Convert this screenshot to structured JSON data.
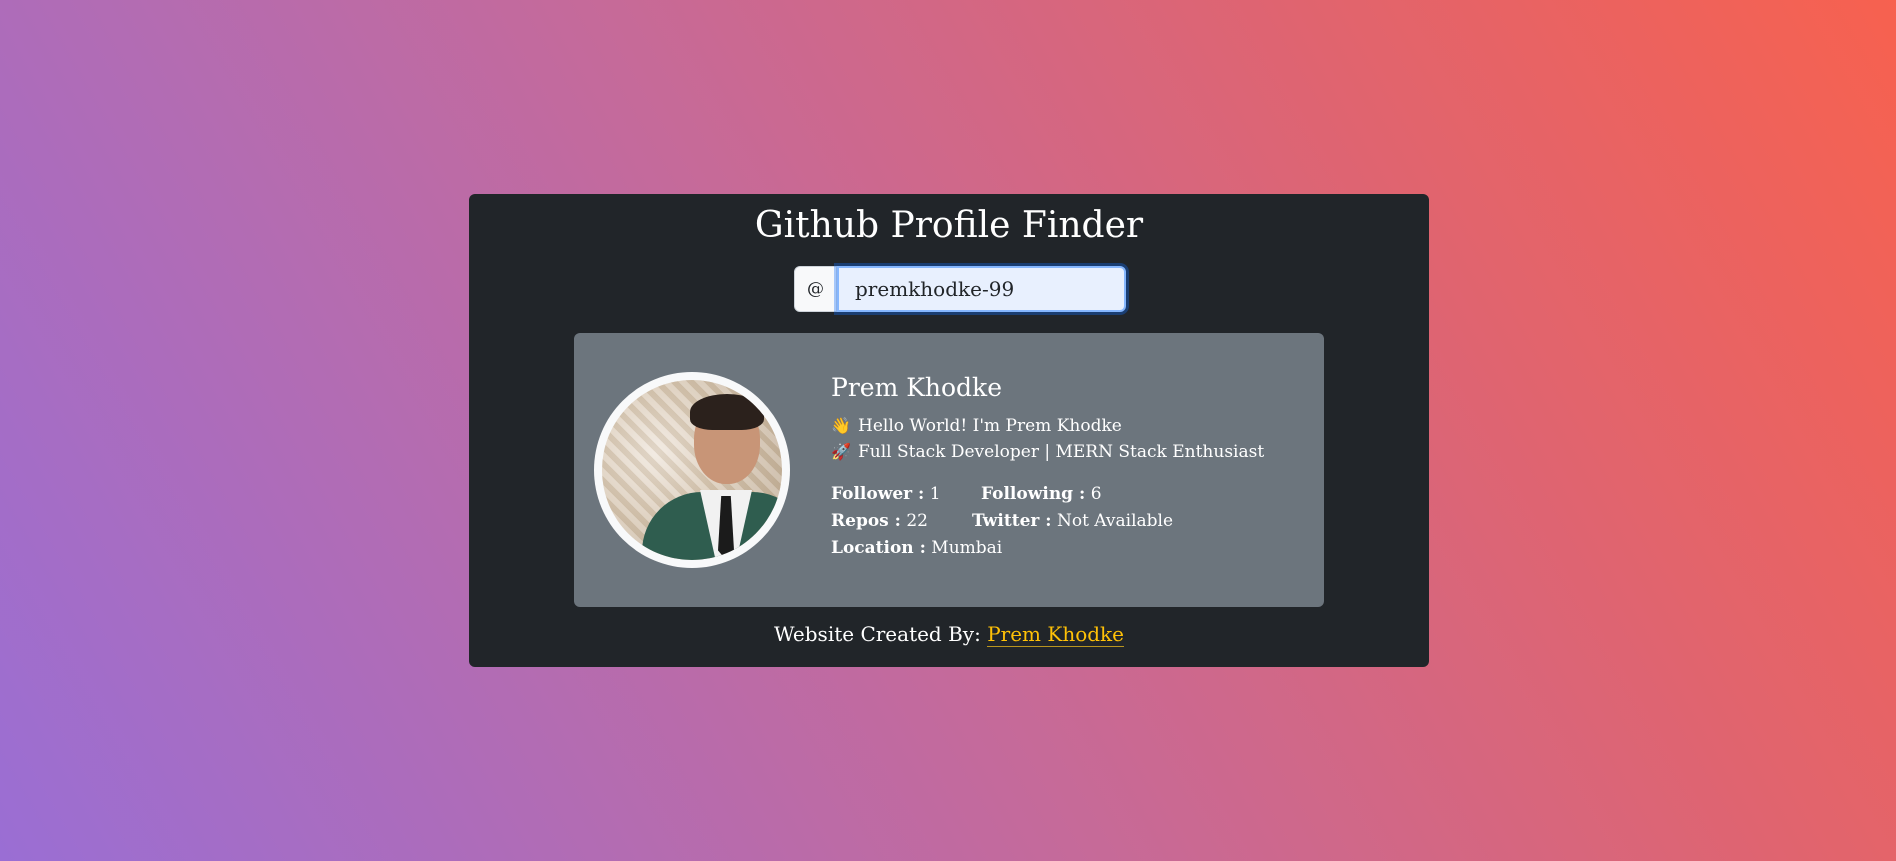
{
  "header": {
    "title": "Github Profile Finder"
  },
  "search": {
    "prefix": "@",
    "value": "premkhodke-99",
    "placeholder": ""
  },
  "profile": {
    "name": "Prem Khodke",
    "bio": [
      {
        "icon": "waving-hand-icon",
        "glyph": "👋",
        "text": "Hello World! I'm Prem Khodke"
      },
      {
        "icon": "rocket-icon",
        "glyph": "🚀",
        "text": "Full Stack Developer | MERN Stack Enthusiast"
      }
    ],
    "stats": {
      "follower_label": "Follower :",
      "follower_value": "1",
      "following_label": "Following :",
      "following_value": "6",
      "repos_label": "Repos :",
      "repos_value": "22",
      "twitter_label": "Twitter :",
      "twitter_value": "Not Available",
      "location_label": "Location :",
      "location_value": "Mumbai"
    }
  },
  "footer": {
    "prefix": "Website Created By:",
    "author_link": "Prem Khodke"
  },
  "colors": {
    "panel": "#212529",
    "card": "#6c757d",
    "link": "#ffc107",
    "input_bg": "#e8f0fe",
    "input_border": "#86b7fe"
  }
}
